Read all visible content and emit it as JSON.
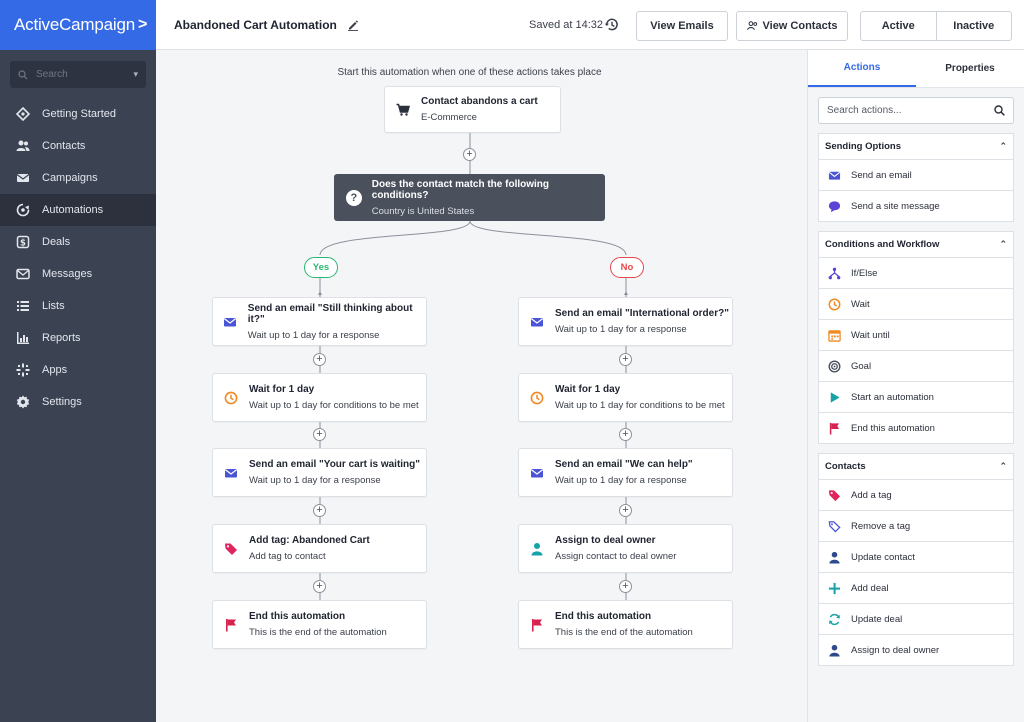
{
  "app": {
    "logo_text": "ActiveCampaign",
    "logo_chevron": ">"
  },
  "sidebar": {
    "search_placeholder": "Search",
    "items": [
      {
        "label": "Getting Started",
        "icon": "diamond-icon"
      },
      {
        "label": "Contacts",
        "icon": "users-icon"
      },
      {
        "label": "Campaigns",
        "icon": "envelope-icon"
      },
      {
        "label": "Automations",
        "icon": "automation-icon"
      },
      {
        "label": "Deals",
        "icon": "dollar-icon"
      },
      {
        "label": "Messages",
        "icon": "message-icon"
      },
      {
        "label": "Lists",
        "icon": "list-icon"
      },
      {
        "label": "Reports",
        "icon": "chart-icon"
      },
      {
        "label": "Apps",
        "icon": "apps-icon"
      },
      {
        "label": "Settings",
        "icon": "gear-icon"
      }
    ],
    "active_index": 3
  },
  "header": {
    "title": "Abandoned Cart Automation",
    "saved": "Saved at 14:32",
    "view_emails": "View Emails",
    "view_contacts": "View Contacts",
    "active": "Active",
    "inactive": "Inactive",
    "active_color": "#2bb673",
    "inactive_color": "#e5484d"
  },
  "canvas": {
    "hint": "Start this automation when one of these actions takes place",
    "trigger": {
      "title": "Contact abandons a cart",
      "subtitle": "E-Commerce"
    },
    "condition": {
      "title": "Does the contact match the following conditions?",
      "subtitle": "Country is United States"
    },
    "yes_label": "Yes",
    "no_label": "No",
    "yes_branch": [
      {
        "title": "Send an email \"Still thinking about it?\"",
        "subtitle": "Wait up to 1 day for a response",
        "icon": "envelope-icon"
      },
      {
        "title": "Wait for 1 day",
        "subtitle": "Wait up to 1 day for conditions to be met",
        "icon": "clock-icon"
      },
      {
        "title": "Send an email \"Your cart is waiting\"",
        "subtitle": "Wait up to 1 day for a response",
        "icon": "envelope-icon"
      },
      {
        "title": "Add tag: Abandoned Cart",
        "subtitle": "Add tag to contact",
        "icon": "tag-icon"
      },
      {
        "title": "End this automation",
        "subtitle": "This is the end of the automation",
        "icon": "flag-icon"
      }
    ],
    "no_branch": [
      {
        "title": "Send an email \"International order?\"",
        "subtitle": "Wait up to 1 day for a response",
        "icon": "envelope-icon"
      },
      {
        "title": "Wait for 1 day",
        "subtitle": "Wait up to 1 day for conditions to be met",
        "icon": "clock-icon"
      },
      {
        "title": "Send an email \"We can help\"",
        "subtitle": "Wait up to 1 day for a response",
        "icon": "envelope-icon"
      },
      {
        "title": "Assign to deal owner",
        "subtitle": "Assign contact to deal owner",
        "icon": "person-icon"
      },
      {
        "title": "End this automation",
        "subtitle": "This is the end of the automation",
        "icon": "flag-icon"
      }
    ]
  },
  "panel": {
    "tab_actions": "Actions",
    "tab_properties": "Properties",
    "search_placeholder": "Search actions...",
    "sections": [
      {
        "title": "Sending Options",
        "items": [
          {
            "label": "Send an email",
            "icon": "envelope-icon"
          },
          {
            "label": "Send a site message",
            "icon": "chat-icon"
          }
        ]
      },
      {
        "title": "Conditions and Workflow",
        "items": [
          {
            "label": "If/Else",
            "icon": "split-icon"
          },
          {
            "label": "Wait",
            "icon": "clock-icon"
          },
          {
            "label": "Wait until",
            "icon": "calendar-icon"
          },
          {
            "label": "Goal",
            "icon": "target-icon"
          },
          {
            "label": "Start an automation",
            "icon": "play-icon"
          },
          {
            "label": "End this automation",
            "icon": "flag-icon"
          }
        ]
      },
      {
        "title": "Contacts",
        "items": [
          {
            "label": "Add a tag",
            "icon": "tag-icon"
          },
          {
            "label": "Remove a tag",
            "icon": "tag-outline-icon"
          },
          {
            "label": "Update contact",
            "icon": "person-icon"
          },
          {
            "label": "Add deal",
            "icon": "plus-icon"
          },
          {
            "label": "Update deal",
            "icon": "refresh-icon"
          },
          {
            "label": "Assign to deal owner",
            "icon": "person-icon"
          }
        ]
      }
    ]
  }
}
